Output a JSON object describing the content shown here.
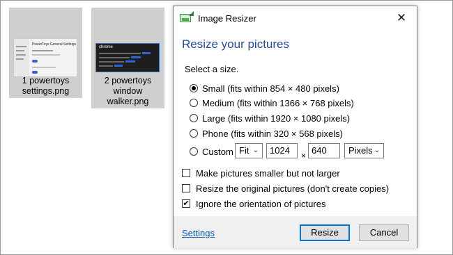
{
  "desktop": {
    "files": [
      {
        "name_line1": "1 powertoys",
        "name_line2": "settings.png",
        "thumb_title": "PowerToys General Settings"
      },
      {
        "name_line1": "2 powertoys",
        "name_line2": "window",
        "name_line3": "walker.png",
        "thumb_title": "chrome"
      }
    ]
  },
  "dialog": {
    "title": "Image Resizer",
    "close_glyph": "✕",
    "heading": "Resize your pictures",
    "select_label": "Select a size.",
    "sizes": [
      {
        "label": "Small (fits within 854 × 480 pixels)",
        "selected": true
      },
      {
        "label": "Medium (fits within 1366 × 768 pixels)",
        "selected": false
      },
      {
        "label": "Large (fits within 1920 × 1080 pixels)",
        "selected": false
      },
      {
        "label": "Phone (fits within 320 × 568 pixels)",
        "selected": false
      }
    ],
    "custom": {
      "label": "Custom",
      "mode": "Fit",
      "width": "1024",
      "times": "×",
      "height": "640",
      "unit": "Pixels",
      "chevron": "⌄"
    },
    "options": [
      {
        "label": "Make pictures smaller but not larger",
        "checked": false
      },
      {
        "label": "Resize the original pictures (don't create copies)",
        "checked": false
      },
      {
        "label": "Ignore the orientation of pictures",
        "checked": true
      }
    ],
    "checkmark": "✔",
    "footer": {
      "settings_link": "Settings",
      "resize_button": "Resize",
      "cancel_button": "Cancel"
    }
  },
  "colors": {
    "heading": "#1f4e9e",
    "link": "#0b57b5",
    "footer_bg": "#f0f0f0",
    "tile_bg": "#cfcfcf"
  }
}
